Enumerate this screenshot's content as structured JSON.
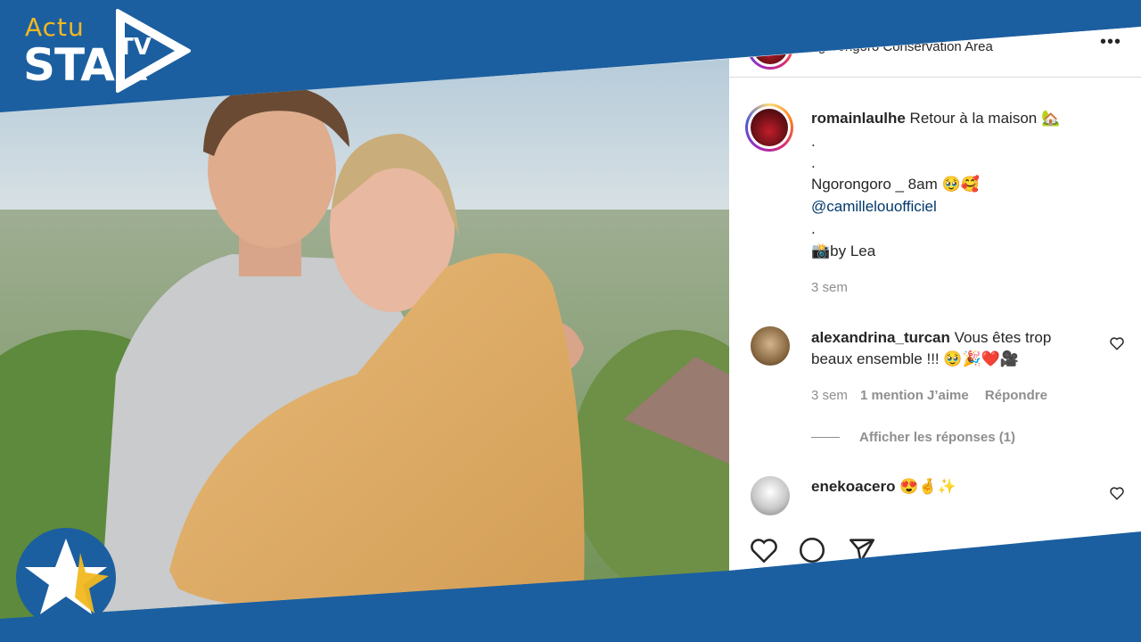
{
  "brand": {
    "actu": "Actu",
    "star": "STAR",
    "tv": "TV",
    "colors": {
      "blue": "#1b5fa0",
      "gold": "#f2b820"
    }
  },
  "post": {
    "location": "Ngorongoro Conservation Area",
    "more_icon": "more-options-icon",
    "author": "romainlaulhe",
    "caption_line1": "Retour à la maison 🏡",
    "dot1": ".",
    "dot2": ".",
    "caption_line2": "Ngorongoro _ 8am 🥹🥰",
    "mention": "@camillelouofficiel",
    "dot3": ".",
    "credit": "📸by Lea",
    "time": "3 sem"
  },
  "comments": [
    {
      "user": "alexandrina_turcan",
      "text_line1": "Vous êtes trop",
      "text_line2": "beaux ensemble !!! 🥹🎉❤️🎥",
      "time": "3 sem",
      "likes": "1 mention J’aime",
      "reply": "Répondre",
      "view_replies": "Afficher les réponses (1)"
    },
    {
      "user": "enekoacero",
      "text": "😍🤞✨"
    }
  ],
  "actions": [
    "heart-icon",
    "comment-icon",
    "share-icon"
  ]
}
